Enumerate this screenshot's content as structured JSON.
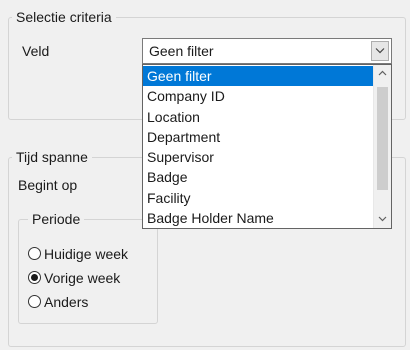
{
  "selection_criteria": {
    "title": "Selectie criteria",
    "field_label": "Veld",
    "combo_value": "Geen filter",
    "options": [
      "Geen filter",
      "Company ID",
      "Location",
      "Department",
      "Supervisor",
      "Badge",
      "Facility",
      "Badge Holder Name"
    ],
    "selected_option": "Geen filter"
  },
  "time_span": {
    "title": "Tijd spanne",
    "starts_label": "Begint op",
    "period": {
      "title": "Periode",
      "options": [
        {
          "label": "Huidige week",
          "checked": false
        },
        {
          "label": "Vorige week",
          "checked": true
        },
        {
          "label": "Anders",
          "checked": false
        }
      ]
    }
  },
  "icons": {
    "combo_arrow": "chevron-down-icon",
    "scroll_up": "scroll-up-arrow-icon",
    "scroll_down": "scroll-down-arrow-icon"
  },
  "colors": {
    "selection": "#0078d7",
    "window": "#f0f0f0"
  }
}
